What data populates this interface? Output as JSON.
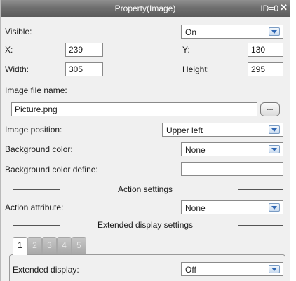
{
  "window": {
    "title": "Property(Image)",
    "id_text": "ID=0",
    "close_glyph": "✕"
  },
  "visible": {
    "label": "Visible:",
    "value": "On"
  },
  "x": {
    "label": "X:",
    "value": "239"
  },
  "y": {
    "label": "Y:",
    "value": "130"
  },
  "width": {
    "label": "Width:",
    "value": "305"
  },
  "height": {
    "label": "Height:",
    "value": "295"
  },
  "image_file": {
    "label": "Image file name:",
    "value": "Picture.png",
    "browse_label": "..."
  },
  "image_position": {
    "label": "Image position:",
    "value": "Upper left"
  },
  "background_color": {
    "label": "Background color:",
    "value": "None"
  },
  "background_color_define": {
    "label": "Background color define:",
    "value": ""
  },
  "action_settings": {
    "title": "Action settings"
  },
  "action_attribute": {
    "label": "Action attribute:",
    "value": "None"
  },
  "extended_display_settings": {
    "title": "Extended display settings",
    "tabs": [
      "1",
      "2",
      "3",
      "4",
      "5"
    ],
    "active_tab": "1"
  },
  "extended_display": {
    "label": "Extended display:",
    "value": "Off"
  },
  "colors": {
    "titlebar": "#6f6f6f",
    "panel_background": "#f0f0f0",
    "dropdown_arrow_accent": "#2f67b4",
    "tab_inactive": "#b5b5b5"
  }
}
